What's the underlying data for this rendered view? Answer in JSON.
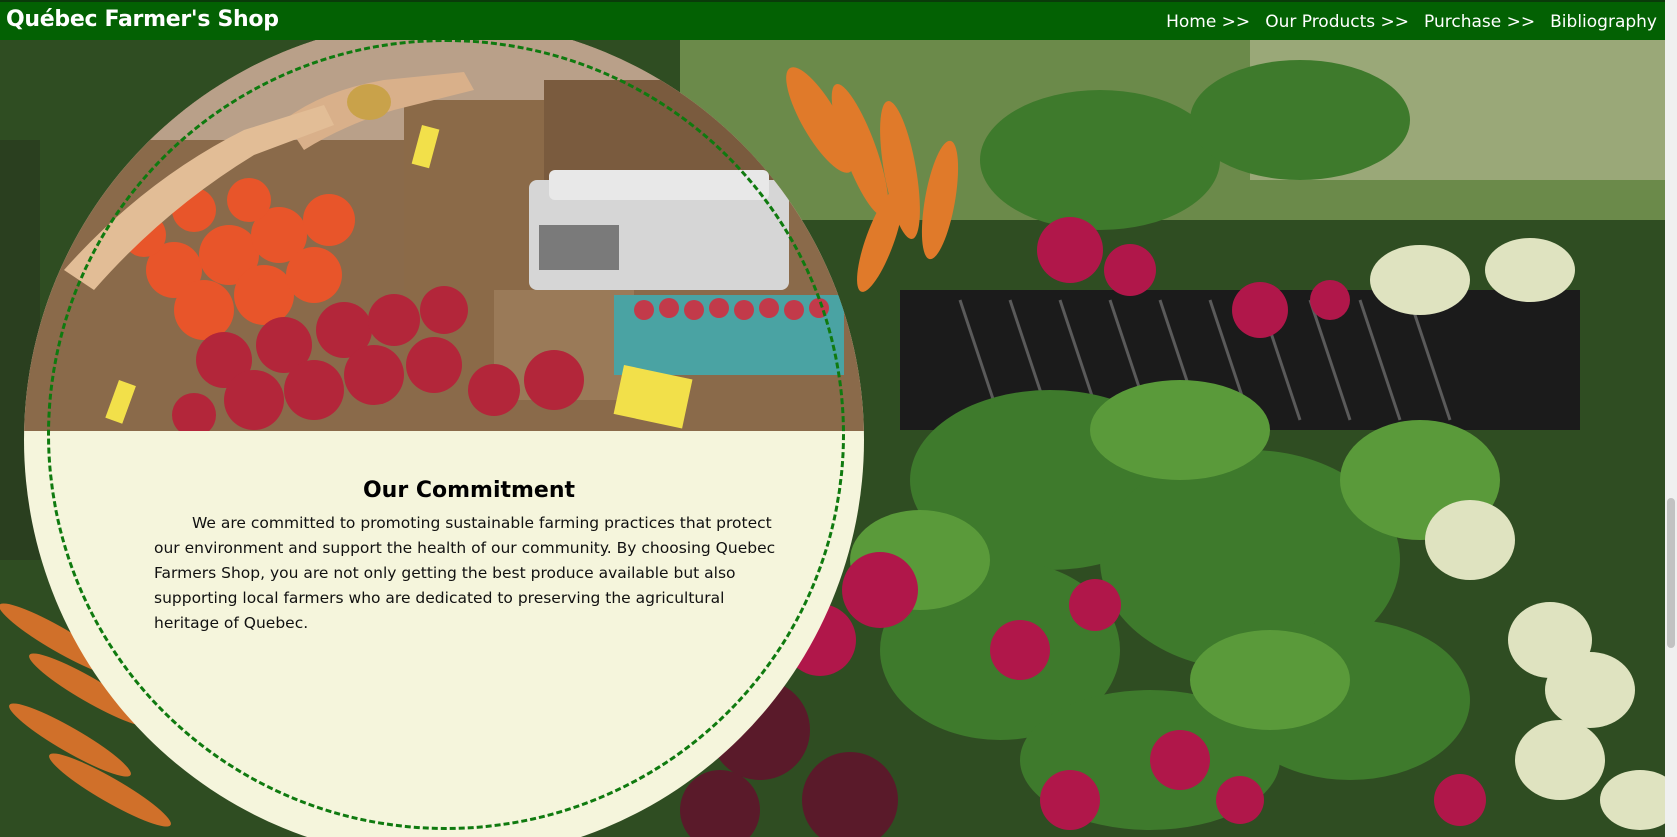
{
  "site": {
    "brand": "Québec Farmer's Shop"
  },
  "nav": {
    "items": [
      {
        "label": "Home >>"
      },
      {
        "label": "Our Products >>"
      },
      {
        "label": "Purchase >>"
      },
      {
        "label": "Bibliography"
      }
    ]
  },
  "commitment": {
    "title": "Our Commitment",
    "body": "We are committed to promoting sustainable farming practices that protect our environment and support the health of our community. By choosing Quebec Farmers Shop, you are not only getting the best produce available but also supporting local farmers who are dedicated to preserving the agricultural heritage of Quebec."
  },
  "colors": {
    "nav_bg": "#036103",
    "card_bg": "#f5f5dc",
    "ring": "#0f7a0f"
  }
}
